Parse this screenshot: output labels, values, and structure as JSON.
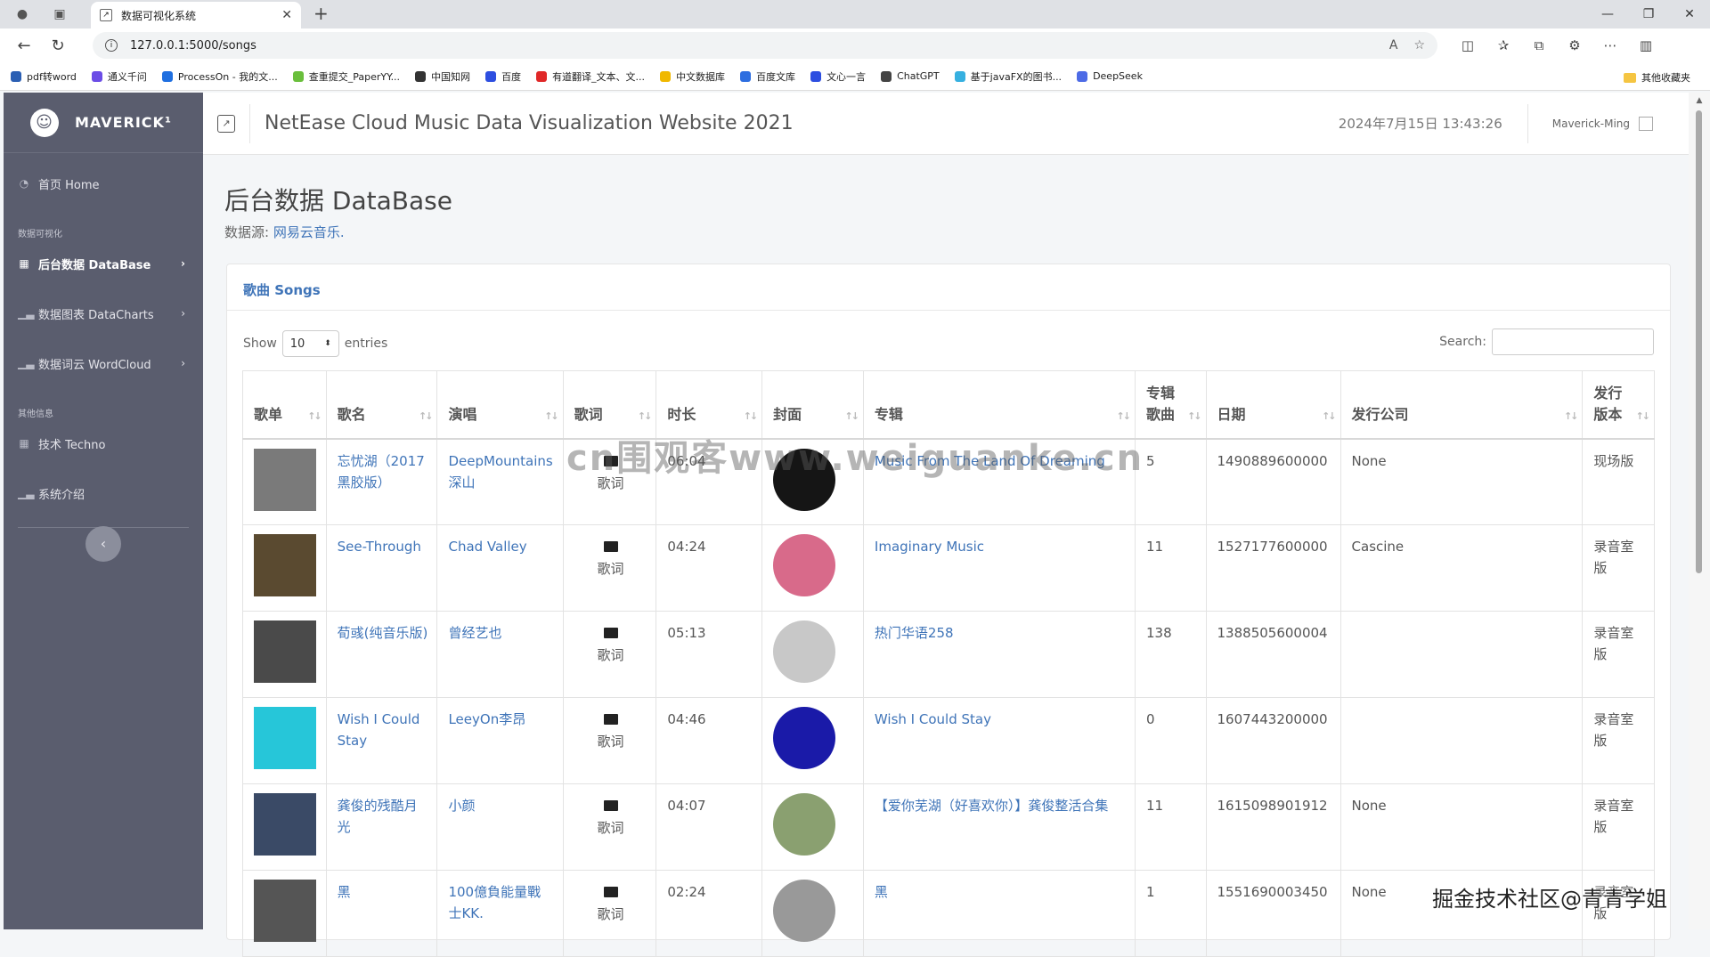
{
  "browser": {
    "tab_title": "数据可视化系统",
    "url": "127.0.0.1:5000/songs",
    "bookmarks": [
      {
        "label": "pdf转word",
        "color": "#2b5fb3"
      },
      {
        "label": "通义千问",
        "color": "#6b4de6"
      },
      {
        "label": "ProcessOn - 我的文...",
        "color": "#1f6fe0"
      },
      {
        "label": "查重提交_PaperYY...",
        "color": "#6abf3c"
      },
      {
        "label": "中国知网",
        "color": "#333333"
      },
      {
        "label": "百度",
        "color": "#2d4ee0"
      },
      {
        "label": "有道翻译_文本、文...",
        "color": "#e02828"
      },
      {
        "label": "中文数据库",
        "color": "#f0b800"
      },
      {
        "label": "百度文库",
        "color": "#2d6ee0"
      },
      {
        "label": "文心一言",
        "color": "#2d4ee0"
      },
      {
        "label": "ChatGPT",
        "color": "#444444"
      },
      {
        "label": "基于javaFX的图书...",
        "color": "#36b0e0"
      },
      {
        "label": "DeepSeek",
        "color": "#4d6be6"
      }
    ],
    "other_bookmarks": "其他收藏夹"
  },
  "sidebar": {
    "brand": "MAVERICK¹",
    "home": "首页 Home",
    "section1": "数据可视化",
    "items": [
      {
        "label": "后台数据 DataBase",
        "icon": "table-icon"
      },
      {
        "label": "数据图表 DataCharts",
        "icon": "bar-chart-icon"
      },
      {
        "label": "数据词云 WordCloud",
        "icon": "bar-chart-icon"
      }
    ],
    "section2": "其他信息",
    "items2": [
      {
        "label": "技术 Techno",
        "icon": "table-icon"
      },
      {
        "label": "系统介绍",
        "icon": "bar-chart-icon"
      }
    ]
  },
  "topbar": {
    "title": "NetEase Cloud Music Data Visualization Website 2021",
    "time": "2024年7月15日 13:43:26",
    "user": "Maverick-Ming"
  },
  "page": {
    "title": "后台数据 DataBase",
    "source_prefix": "数据源: ",
    "source_link": "网易云音乐."
  },
  "card": {
    "title": "歌曲 Songs",
    "show": "Show",
    "entries_value": "10",
    "entries": "entries",
    "search": "Search:"
  },
  "table": {
    "headers": [
      "歌单",
      "歌名",
      "演唱",
      "歌词",
      "时长",
      "封面",
      "专辑",
      "专辑歌曲",
      "日期",
      "发行公司",
      "发行版本"
    ],
    "rows": [
      {
        "name": "忘忧湖（2017黑胶版）",
        "artist": "DeepMountains深山",
        "lyric": "歌词",
        "duration": "06:04",
        "album": "Music From The Land Of Dreaming",
        "tracks": "5",
        "date": "1490889600000",
        "company": "None",
        "version": "现场版",
        "thumb": "#7a7a7a",
        "cover": "#151515"
      },
      {
        "name": "See-Through",
        "artist": "Chad Valley",
        "lyric": "歌词",
        "duration": "04:24",
        "album": "Imaginary Music",
        "tracks": "11",
        "date": "1527177600000",
        "company": "Cascine",
        "version": "录音室版",
        "thumb": "#5a4a30",
        "cover": "#d86a8a"
      },
      {
        "name": "荀彧(纯音乐版)",
        "artist": "曾经艺也",
        "lyric": "歌词",
        "duration": "05:13",
        "album": "热门华语258",
        "tracks": "138",
        "date": "1388505600004",
        "company": "",
        "version": "录音室版",
        "thumb": "#4a4a4a",
        "cover": "#c8c8c8"
      },
      {
        "name": "Wish I Could Stay",
        "artist": "LeeyOn李昂",
        "lyric": "歌词",
        "duration": "04:46",
        "album": "Wish I Could Stay",
        "tracks": "0",
        "date": "1607443200000",
        "company": "",
        "version": "录音室版",
        "thumb": "#26c6d9",
        "cover": "#1a1aa8"
      },
      {
        "name": "龚俊的残酷月光",
        "artist": "小颜",
        "lyric": "歌词",
        "duration": "04:07",
        "album": "【爱你芜湖（好喜欢你）】龚俊整活合集",
        "tracks": "11",
        "date": "1615098901912",
        "company": "None",
        "version": "录音室版",
        "thumb": "#3a4a66",
        "cover": "#8aa070"
      },
      {
        "name": "黑",
        "artist": "100億負能量戰士KK.",
        "lyric": "歌词",
        "duration": "02:24",
        "album": "黑",
        "tracks": "1",
        "date": "1551690003450",
        "company": "None",
        "version": "录音室版",
        "thumb": "#555555",
        "cover": "#999999"
      }
    ]
  },
  "watermarks": {
    "center": "cn围观客www.weiguanke.cn",
    "corner": "掘金技术社区@青青学姐"
  }
}
